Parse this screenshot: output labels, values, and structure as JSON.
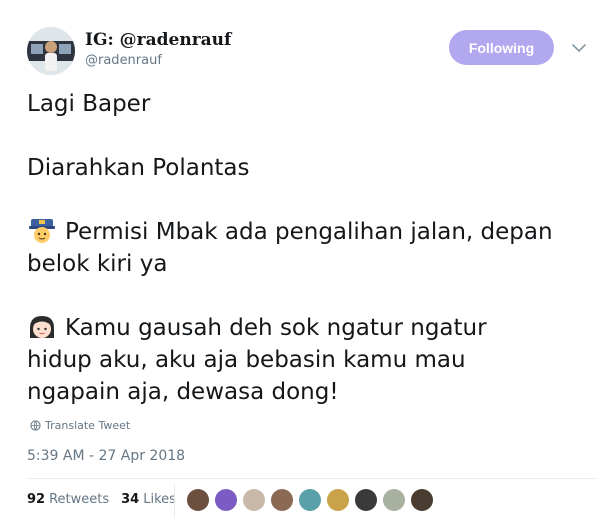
{
  "author": {
    "name": "IG: @radenrauf",
    "handle": "@radenrauf",
    "avatar_icon": "profile-photo"
  },
  "follow_button": {
    "label": "Following",
    "color": "#b2a8f0"
  },
  "tweet": {
    "line1": "Lagi Baper",
    "line2": "Diarahkan Polantas",
    "line3_emoji": "police-officer-emoji",
    "line3": "Permisi Mbak ada pengalihan jalan, depan\nbelok kiri ya",
    "line4_emoji": "girl-face-emoji",
    "line4": "Kamu gausah deh sok ngatur ngatur\nhidup aku, aku aja bebasin kamu mau\nngapain aja, dewasa dong!"
  },
  "translate_label": "Translate Tweet",
  "timestamp": "5:39 AM - 27 Apr 2018",
  "stats": {
    "retweets_count": "92",
    "retweets_label": "Retweets",
    "likes_count": "34",
    "likes_label": "Likes"
  },
  "likers": [
    {
      "color": "#6b4f3f"
    },
    {
      "color": "#7c5cc4"
    },
    {
      "color": "#c9b8a8"
    },
    {
      "color": "#8a6a52"
    },
    {
      "color": "#5aa0a8"
    },
    {
      "color": "#c9a24a"
    },
    {
      "color": "#3a3a3a"
    },
    {
      "color": "#a8b0a0"
    },
    {
      "color": "#4a3c30"
    }
  ]
}
